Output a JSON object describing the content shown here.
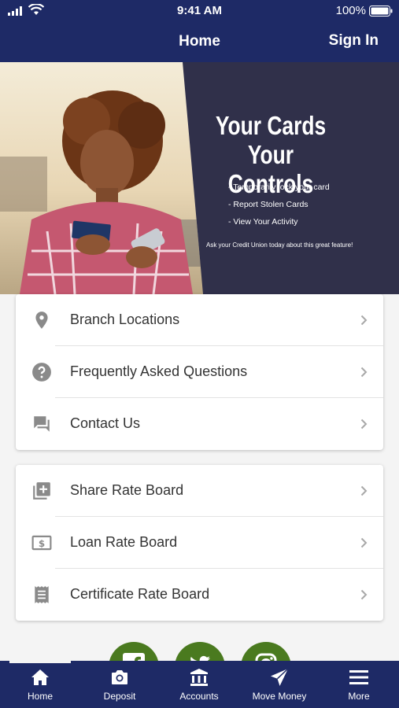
{
  "status_bar": {
    "time": "9:41 AM",
    "battery": "100%"
  },
  "nav": {
    "title": "Home",
    "sign_in": "Sign In"
  },
  "banner": {
    "headline_1": "Your Cards",
    "headline_2": "Your Controls",
    "bullets": [
      "- Temporarily lock your card",
      "- Report Stolen Cards",
      "- View Your Activity"
    ],
    "footer": "Ask your Credit Union today about this great feature!"
  },
  "menu_group_1": [
    {
      "label": "Branch Locations",
      "icon": "location-pin-icon"
    },
    {
      "label": "Frequently Asked Questions",
      "icon": "help-circle-icon"
    },
    {
      "label": "Contact Us",
      "icon": "chat-icon"
    }
  ],
  "menu_group_2": [
    {
      "label": "Share Rate Board",
      "icon": "add-box-icon"
    },
    {
      "label": "Loan Rate Board",
      "icon": "dollar-bill-icon"
    },
    {
      "label": "Certificate Rate Board",
      "icon": "receipt-icon"
    }
  ],
  "social": [
    "facebook-icon",
    "twitter-icon",
    "instagram-icon"
  ],
  "tabs": [
    {
      "label": "Home",
      "icon": "home-icon"
    },
    {
      "label": "Deposit",
      "icon": "camera-icon"
    },
    {
      "label": "Accounts",
      "icon": "bank-icon"
    },
    {
      "label": "Move Money",
      "icon": "send-icon"
    },
    {
      "label": "More",
      "icon": "menu-icon"
    }
  ],
  "colors": {
    "nav": "#1e2a66",
    "banner": "#30304a",
    "social": "#4a7a1f"
  }
}
